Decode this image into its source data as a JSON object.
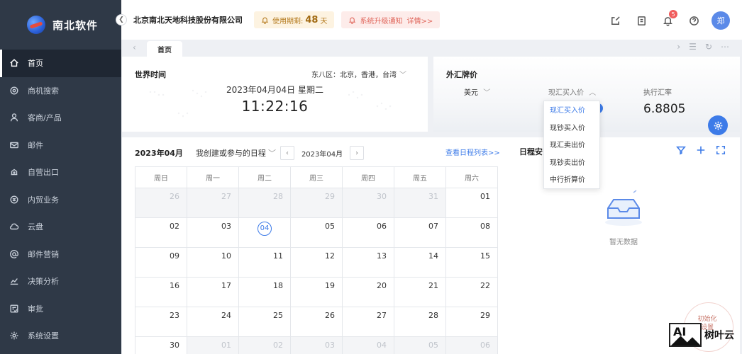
{
  "app": {
    "name": "南北软件"
  },
  "sidebar": {
    "items": [
      {
        "label": "首页",
        "icon": "home-icon",
        "active": true
      },
      {
        "label": "商机搜索",
        "icon": "search-icon",
        "active": false
      },
      {
        "label": "客商/产品",
        "icon": "user-icon",
        "active": false
      },
      {
        "label": "邮件",
        "icon": "mail-icon",
        "active": false
      },
      {
        "label": "自营出口",
        "icon": "export-icon",
        "active": false
      },
      {
        "label": "内贸业务",
        "icon": "trade-icon",
        "active": false
      },
      {
        "label": "云盘",
        "icon": "cloud-icon",
        "active": false
      },
      {
        "label": "邮件营销",
        "icon": "at-icon",
        "active": false
      },
      {
        "label": "决策分析",
        "icon": "chart-icon",
        "active": false
      },
      {
        "label": "审批",
        "icon": "approval-icon",
        "active": false
      },
      {
        "label": "系统设置",
        "icon": "gear-icon",
        "active": false
      }
    ]
  },
  "header": {
    "company": "北京南北天地科技股份有限公司",
    "trial_prefix": "使用期剩:",
    "trial_days": "48",
    "trial_suffix": "天",
    "upgrade_text": "系统升级通知",
    "upgrade_link": "详情>>",
    "notification_count": "5",
    "avatar_text": "郑"
  },
  "tabs": {
    "home": "首页"
  },
  "world_time": {
    "title": "世界时间",
    "timezone": "东八区：北京，香港，台湾",
    "date": "2023年04月04日 星期二",
    "time": "11:22:16"
  },
  "fx": {
    "title": "外汇牌价",
    "currency": "美元",
    "type": "现汇买入价",
    "rate_label": "执行汇率",
    "rate_value": "6.8805",
    "options": [
      "现汇买入价",
      "现钞买入价",
      "现汇卖出价",
      "现钞卖出价",
      "中行折算价"
    ]
  },
  "calendar": {
    "month_title": "2023年04月",
    "filter": "我创建或参与的日程",
    "nav_month": "2023年04月",
    "view_list": "查看日程列表>>",
    "weekdays": [
      "周日",
      "周一",
      "周二",
      "周三",
      "周四",
      "周五",
      "周六"
    ],
    "weeks": [
      [
        "26",
        "27",
        "28",
        "29",
        "30",
        "31",
        "01"
      ],
      [
        "02",
        "03",
        "04",
        "05",
        "06",
        "07",
        "08"
      ],
      [
        "09",
        "10",
        "11",
        "12",
        "13",
        "14",
        "15"
      ],
      [
        "16",
        "17",
        "18",
        "19",
        "20",
        "21",
        "22"
      ],
      [
        "23",
        "24",
        "25",
        "26",
        "27",
        "28",
        "29"
      ],
      [
        "30",
        "01",
        "02",
        "03",
        "04",
        "05",
        "06"
      ]
    ],
    "other_month": [
      [
        true,
        true,
        true,
        true,
        true,
        true,
        false
      ],
      [
        false,
        false,
        false,
        false,
        false,
        false,
        false
      ],
      [
        false,
        false,
        false,
        false,
        false,
        false,
        false
      ],
      [
        false,
        false,
        false,
        false,
        false,
        false,
        false
      ],
      [
        false,
        false,
        false,
        false,
        false,
        false,
        false
      ],
      [
        false,
        true,
        true,
        true,
        true,
        true,
        true
      ]
    ],
    "today": "04"
  },
  "schedule": {
    "title": "日程安",
    "empty_text": "暂无数据"
  },
  "init_badge": {
    "line1": "初始化",
    "line2": "设置"
  },
  "watermark": {
    "ai": "AI",
    "text": "树叶云"
  }
}
